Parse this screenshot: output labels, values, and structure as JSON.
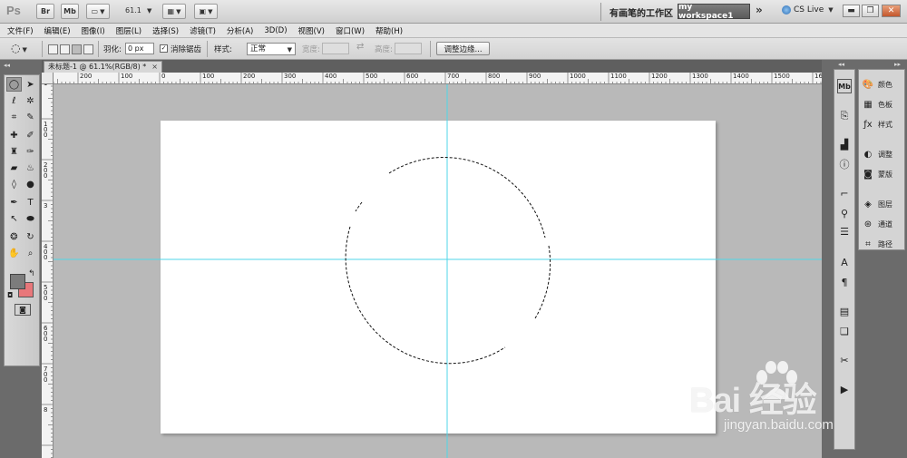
{
  "app": {
    "logo": "Ps",
    "bridge_btn": "Br",
    "minibridge_btn": "Mb",
    "zoom": "61.1",
    "workspace_label": "有画笔的工作区",
    "workspace_name": "my workspace1",
    "more": "»",
    "cs_live": "CS Live"
  },
  "menu": [
    "文件(F)",
    "编辑(E)",
    "图像(I)",
    "图层(L)",
    "选择(S)",
    "滤镜(T)",
    "分析(A)",
    "3D(D)",
    "视图(V)",
    "窗口(W)",
    "帮助(H)"
  ],
  "options": {
    "feather_label": "羽化:",
    "feather_value": "0 px",
    "antialias_label": "消除锯齿",
    "style_label": "样式:",
    "style_value": "正常",
    "width_label": "宽度:",
    "height_label": "高度:",
    "refine_btn": "调整边缘..."
  },
  "document": {
    "tab_title": "未标题-1 @ 61.1%(RGB/8) *",
    "close": "×"
  },
  "ruler_top": [
    "200",
    "100",
    "0",
    "100",
    "200",
    "300",
    "400",
    "500",
    "600",
    "700",
    "800",
    "900",
    "1000",
    "1100",
    "1200",
    "1300",
    "1400",
    "1500",
    "160"
  ],
  "ruler_left": [
    "1",
    "1 0 0",
    "2 0 0",
    "3",
    "4 0 0",
    "5 0 0",
    "6 0 0",
    "7 0 0",
    "8"
  ],
  "panels": [
    {
      "icon": "color-icon",
      "label": "颜色"
    },
    {
      "icon": "swatches-icon",
      "label": "色板"
    },
    {
      "icon": "styles-icon",
      "label": "样式"
    },
    {
      "icon": "adjustments-icon",
      "label": "调整"
    },
    {
      "icon": "masks-icon",
      "label": "蒙版"
    },
    {
      "icon": "layers-icon",
      "label": "图层"
    },
    {
      "icon": "channels-icon",
      "label": "通道"
    },
    {
      "icon": "paths-icon",
      "label": "路径"
    }
  ],
  "watermark": {
    "brand": "Bai  经验",
    "url": "jingyan.baidu.com"
  },
  "colors": {
    "foreground": "#7c7c7c",
    "background": "#e8777a",
    "guide": "#4fd6e8"
  }
}
